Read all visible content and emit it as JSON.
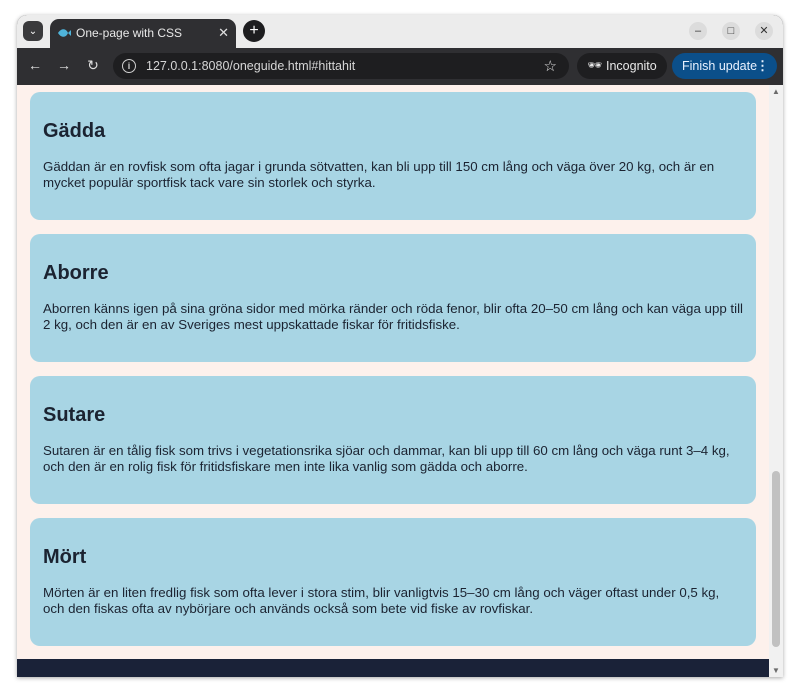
{
  "browser": {
    "tab_title": "One-page with CSS",
    "url": "127.0.0.1:8080/oneguide.html#hittahit",
    "incognito_label": "Incognito",
    "update_label": "Finish update"
  },
  "cards": [
    {
      "title": "Gädda",
      "text": "Gäddan är en rovfisk som ofta jagar i grunda sötvatten, kan bli upp till 150 cm lång och väga över 20 kg, och är en mycket populär sportfisk tack vare sin storlek och styrka."
    },
    {
      "title": "Aborre",
      "text": "Aborren känns igen på sina gröna sidor med mörka ränder och röda fenor, blir ofta 20–50 cm lång och kan väga upp till 2 kg, och den är en av Sveriges mest uppskattade fiskar för fritidsfiske."
    },
    {
      "title": "Sutare",
      "text": "Sutaren är en tålig fisk som trivs i vegetationsrika sjöar och dammar, kan bli upp till 60 cm lång och väga runt 3–4 kg, och den är en rolig fisk för fritidsfiskare men inte lika vanlig som gädda och aborre."
    },
    {
      "title": "Mört",
      "text": "Mörten är en liten fredlig fisk som ofta lever i stora stim, blir vanligtvis 15–30 cm lång och väger oftast under 0,5 kg, och den fiskas ofta av nybörjare och används också som bete vid fiske av rovfiskar."
    }
  ]
}
